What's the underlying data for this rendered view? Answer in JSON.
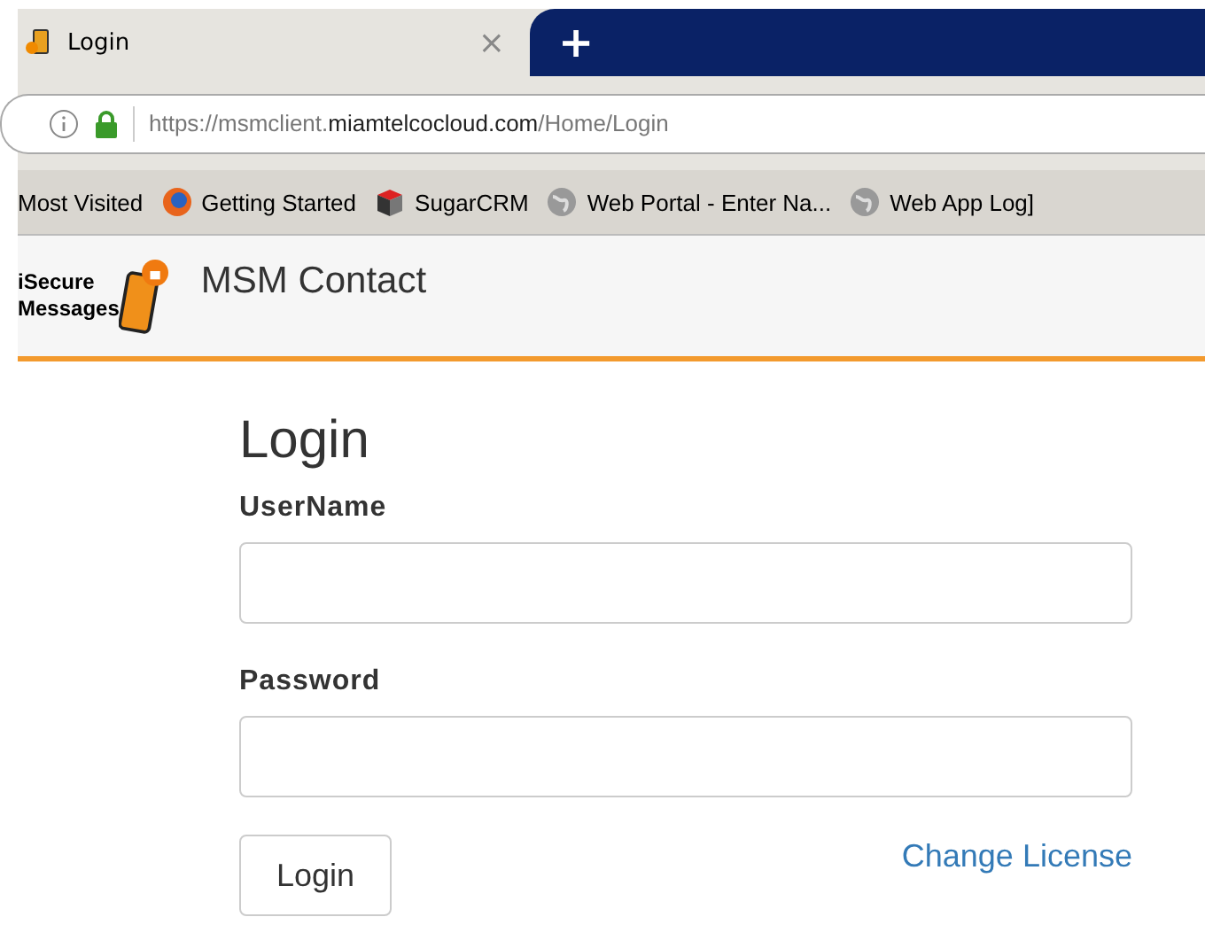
{
  "tab": {
    "title": "Login",
    "close": "×",
    "new_tab": "+"
  },
  "address_bar": {
    "url_prefix": "https://msmclient.",
    "url_domain": "miamtelcocloud.com",
    "url_path": "/Home/Login"
  },
  "bookmarks": [
    {
      "label": "Most Visited",
      "kind": "folder"
    },
    {
      "label": "Getting Started",
      "kind": "firefox"
    },
    {
      "label": "SugarCRM",
      "kind": "cube"
    },
    {
      "label": "Web Portal - Enter Na...",
      "kind": "globe"
    },
    {
      "label": "Web App Log]",
      "kind": "globe"
    }
  ],
  "header": {
    "logo_line1": "iSecure",
    "logo_line2": "Messages",
    "title": "MSM Contact"
  },
  "login": {
    "heading": "Login",
    "username_label": "UserName",
    "password_label": "Password",
    "button": "Login",
    "link": "Change License"
  }
}
